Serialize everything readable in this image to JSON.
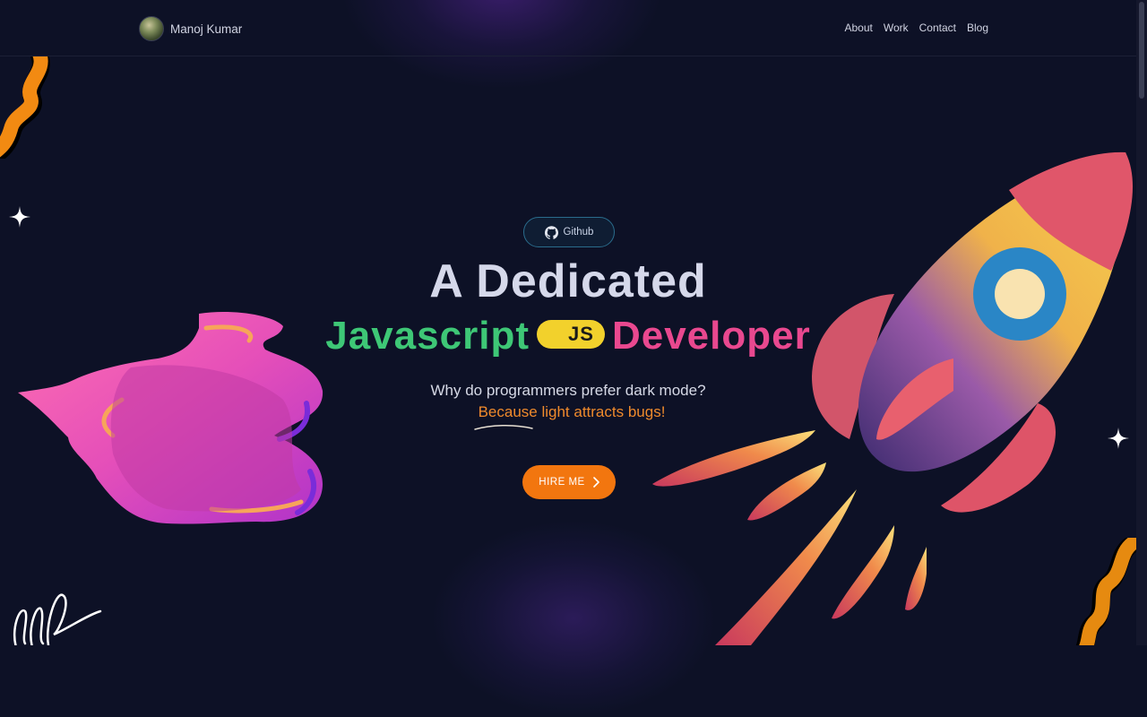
{
  "header": {
    "name": "Manoj Kumar",
    "nav": [
      "About",
      "Work",
      "Contact",
      "Blog"
    ]
  },
  "hero": {
    "github_label": "Github",
    "headline_line1": "A Dedicated",
    "headline_word1": "Javascript",
    "badge_text": "JS",
    "headline_word2": "Developer",
    "joke_question": "Why do programmers prefer dark mode?",
    "joke_answer": "Because light attracts bugs!",
    "cta_label": "HIRE ME"
  },
  "icons": [
    "github-icon",
    "chevron-right-icon",
    "sparkle-icon"
  ],
  "colors": {
    "background": "#0d1126",
    "green": "#3ec776",
    "pink": "#e9488f",
    "yellow": "#f2d12c",
    "orange": "#f2760f"
  }
}
